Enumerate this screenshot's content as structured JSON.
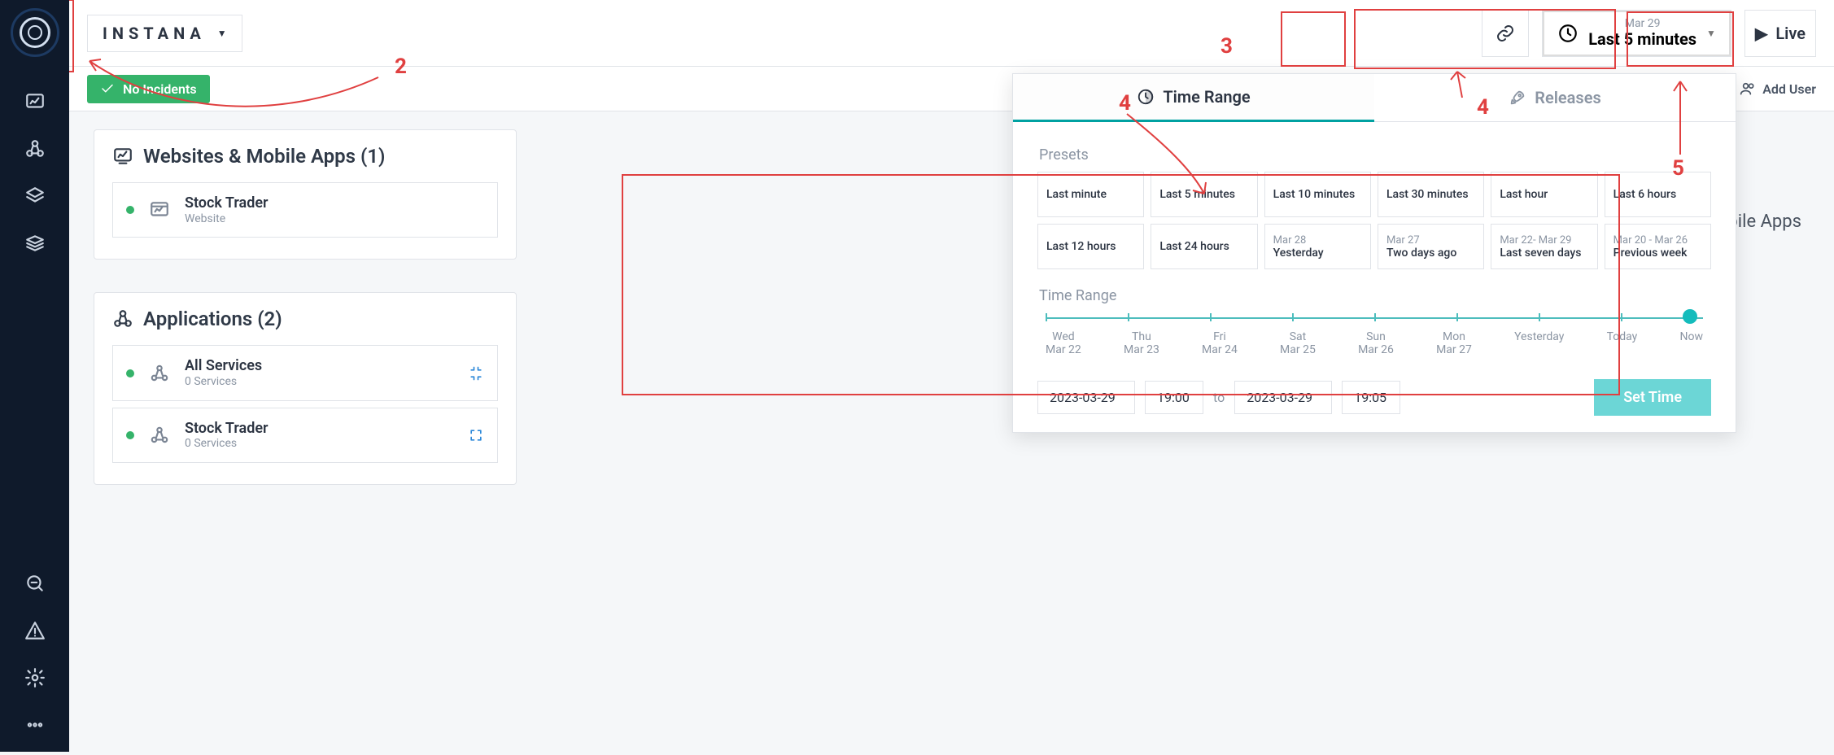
{
  "brand": "INSTANA",
  "topbar": {
    "link_button_title": "Copy link",
    "time_picker": {
      "date": "Mar 29",
      "range": "Last 5 minutes"
    },
    "live_label": "Live"
  },
  "secondary": {
    "no_incidents": "No Incidents",
    "add_user": "Add User"
  },
  "content": {
    "websites": {
      "title": "Websites & Mobile Apps (1)",
      "items": [
        {
          "title": "Stock Trader",
          "subtitle": "Website"
        }
      ]
    },
    "applications": {
      "title": "Applications (2)",
      "items": [
        {
          "title": "All Services",
          "subtitle": "0 Services"
        },
        {
          "title": "Stock Trader",
          "subtitle": "0 Services"
        }
      ]
    },
    "behind_label": "bile Apps"
  },
  "popup": {
    "tabs": {
      "time_range": "Time Range",
      "releases": "Releases"
    },
    "presets_label": "Presets",
    "presets": [
      {
        "main": "Last minute"
      },
      {
        "main": "Last 5 minutes"
      },
      {
        "main": "Last 10 minutes"
      },
      {
        "main": "Last 30 minutes"
      },
      {
        "main": "Last hour"
      },
      {
        "main": "Last 6 hours"
      },
      {
        "main": "Last 12 hours"
      },
      {
        "main": "Last 24 hours"
      },
      {
        "sub": "Mar 28",
        "main": "Yesterday"
      },
      {
        "sub": "Mar 27",
        "main": "Two days ago"
      },
      {
        "sub": "Mar 22- Mar 29",
        "main": "Last seven days"
      },
      {
        "sub": "Mar 20 - Mar 26",
        "main": "Previous week"
      }
    ],
    "time_range_label": "Time Range",
    "slider_labels": [
      {
        "day": "Wed",
        "date": "Mar 22"
      },
      {
        "day": "Thu",
        "date": "Mar 23"
      },
      {
        "day": "Fri",
        "date": "Mar 24"
      },
      {
        "day": "Sat",
        "date": "Mar 25"
      },
      {
        "day": "Sun",
        "date": "Mar 26"
      },
      {
        "day": "Mon",
        "date": "Mar 27"
      },
      {
        "day": "Yesterday",
        "date": ""
      },
      {
        "day": "Today",
        "date": ""
      },
      {
        "day": "Now",
        "date": ""
      }
    ],
    "datetime": {
      "from_date": "2023-03-29",
      "from_time": "19:00",
      "to_date": "2023-03-29",
      "to_time": "19:05",
      "sep": "to",
      "set_time": "Set Time"
    }
  },
  "annotations": {
    "n2": "2",
    "n3": "3",
    "n4": "4",
    "n5": "5"
  }
}
